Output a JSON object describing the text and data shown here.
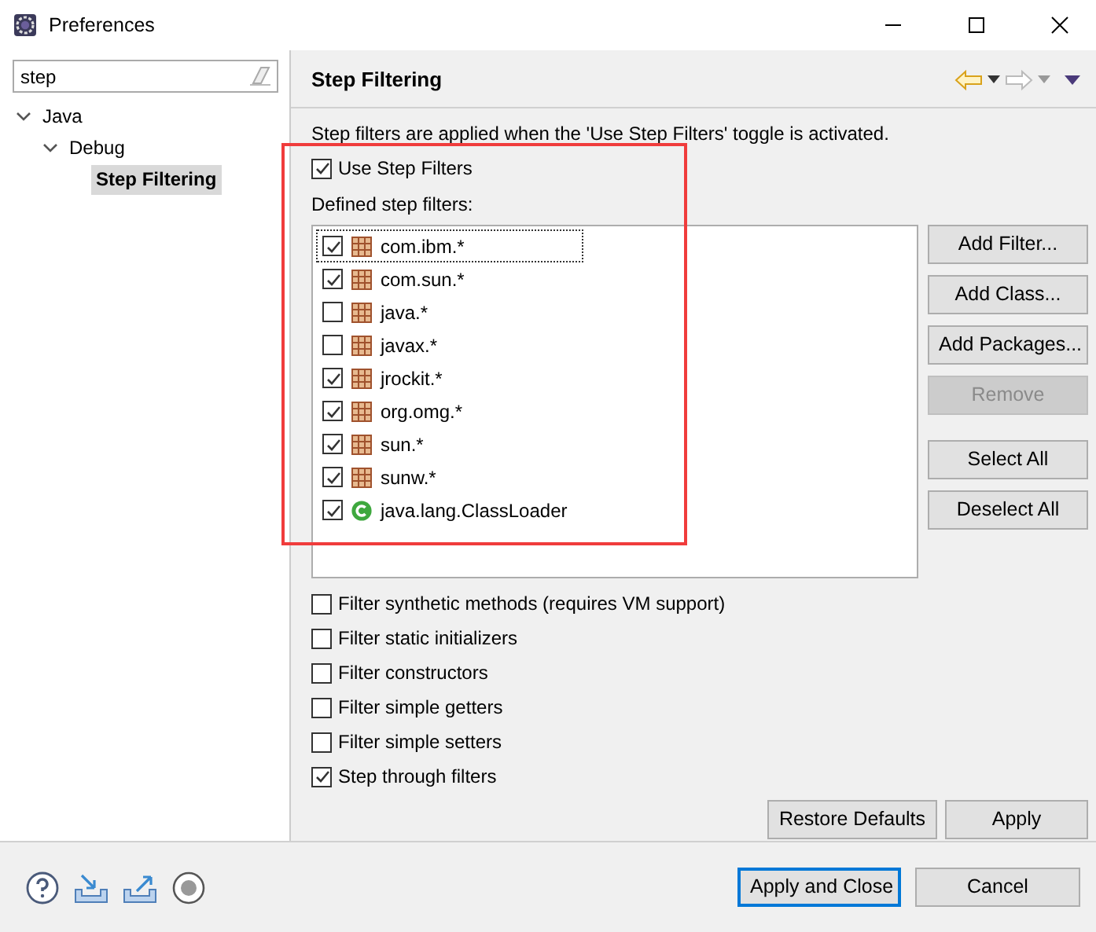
{
  "window": {
    "title": "Preferences"
  },
  "sidebar": {
    "search": {
      "value": "step"
    },
    "tree": [
      {
        "label": "Java",
        "expanded": true,
        "selected": false,
        "children": [
          {
            "label": "Debug",
            "expanded": true,
            "selected": false,
            "children": [
              {
                "label": "Step Filtering",
                "selected": true
              }
            ]
          }
        ]
      }
    ]
  },
  "page": {
    "title": "Step Filtering",
    "description": "Step filters are applied when the 'Use Step Filters' toggle is activated.",
    "use_step_filters": {
      "label": "Use Step Filters",
      "checked": true
    },
    "filters_label": "Defined step filters:",
    "filters": [
      {
        "kind": "package",
        "name": "com.ibm.*",
        "checked": true,
        "focused": true
      },
      {
        "kind": "package",
        "name": "com.sun.*",
        "checked": true,
        "focused": false
      },
      {
        "kind": "package",
        "name": "java.*",
        "checked": false,
        "focused": false
      },
      {
        "kind": "package",
        "name": "javax.*",
        "checked": false,
        "focused": false
      },
      {
        "kind": "package",
        "name": "jrockit.*",
        "checked": true,
        "focused": false
      },
      {
        "kind": "package",
        "name": "org.omg.*",
        "checked": true,
        "focused": false
      },
      {
        "kind": "package",
        "name": "sun.*",
        "checked": true,
        "focused": false
      },
      {
        "kind": "package",
        "name": "sunw.*",
        "checked": true,
        "focused": false
      },
      {
        "kind": "class",
        "name": "java.lang.ClassLoader",
        "checked": true,
        "focused": false
      }
    ],
    "filter_button_groups": [
      [
        {
          "label": "Add Filter...",
          "disabled": false
        },
        {
          "label": "Add Class...",
          "disabled": false
        },
        {
          "label": "Add Packages...",
          "disabled": false
        },
        {
          "label": "Remove",
          "disabled": true
        }
      ],
      [
        {
          "label": "Select All",
          "disabled": false
        },
        {
          "label": "Deselect All",
          "disabled": false
        }
      ]
    ],
    "options": [
      {
        "label": "Filter synthetic methods (requires VM support)",
        "checked": false
      },
      {
        "label": "Filter static initializers",
        "checked": false
      },
      {
        "label": "Filter constructors",
        "checked": false
      },
      {
        "label": "Filter simple getters",
        "checked": false
      },
      {
        "label": "Filter simple setters",
        "checked": false
      },
      {
        "label": "Step through filters",
        "checked": true
      }
    ],
    "page_buttons": [
      "Restore Defaults",
      "Apply"
    ]
  },
  "footer": {
    "buttons": [
      {
        "label": "Apply and Close",
        "default": true
      },
      {
        "label": "Cancel",
        "default": false
      }
    ]
  }
}
